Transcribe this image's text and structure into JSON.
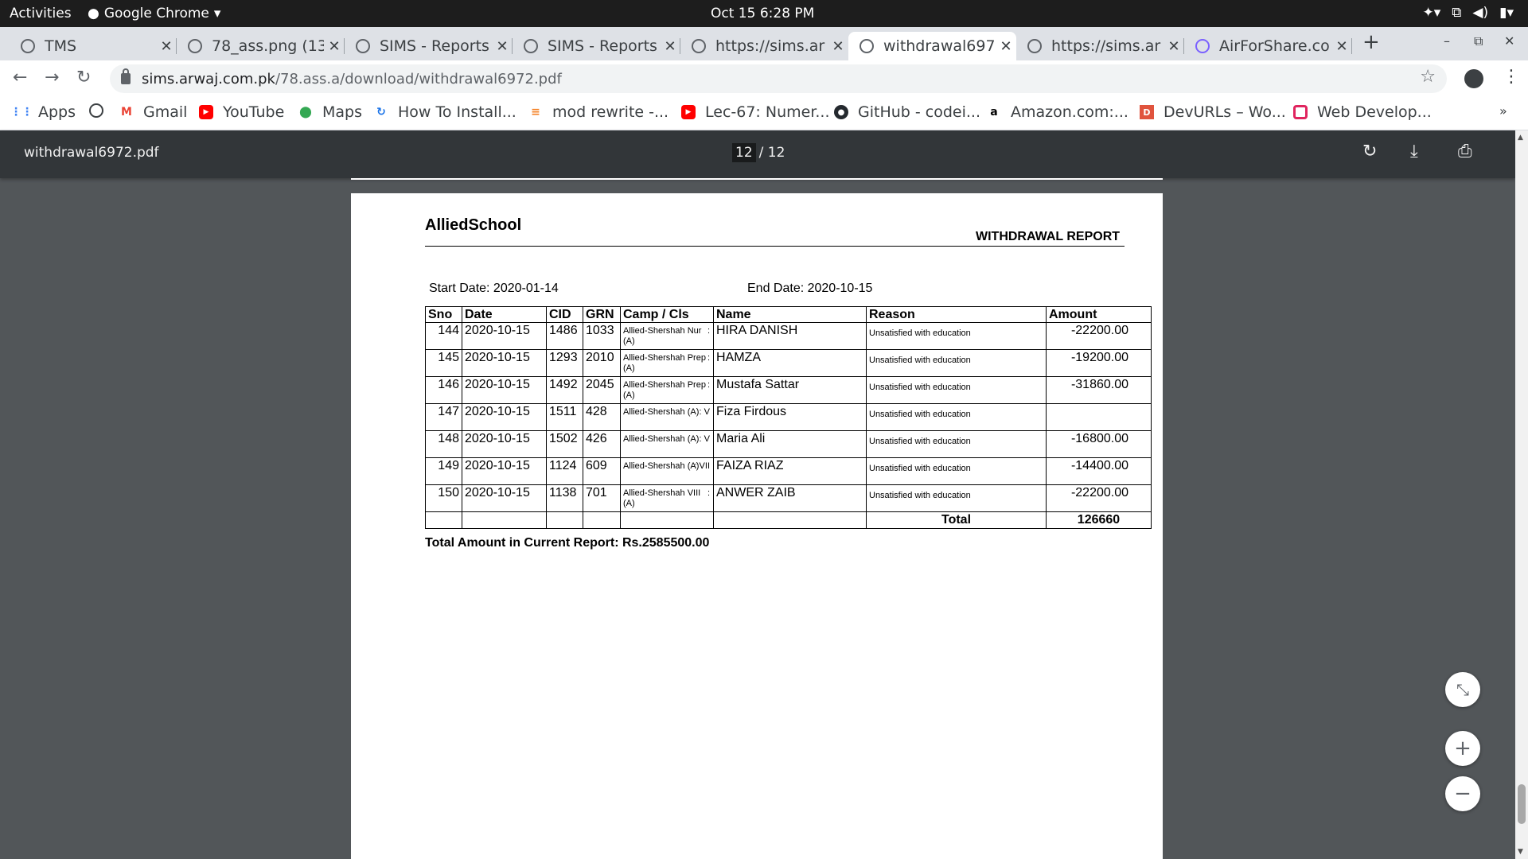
{
  "system": {
    "activities": "Activities",
    "app_name": "Google Chrome",
    "clock": "Oct 15  6:28 PM"
  },
  "tabs": [
    {
      "title": "TMS"
    },
    {
      "title": "78_ass.png (13"
    },
    {
      "title": "SIMS - Reports"
    },
    {
      "title": "SIMS - Reports"
    },
    {
      "title": "https://sims.ar"
    },
    {
      "title": "withdrawal697"
    },
    {
      "title": "https://sims.ar"
    },
    {
      "title": "AirForShare.co"
    }
  ],
  "address": {
    "host": "sims.arwaj.com.pk",
    "path": "/78.ass.a/download/withdrawal6972.pdf"
  },
  "bookmarks": [
    {
      "label": "Apps",
      "icon": "apps-grid-icon"
    },
    {
      "label": "",
      "icon": "globe-icon"
    },
    {
      "label": "Gmail",
      "icon": "gmail-icon"
    },
    {
      "label": "YouTube",
      "icon": "youtube-icon"
    },
    {
      "label": "Maps",
      "icon": "maps-icon"
    },
    {
      "label": "How To Install...",
      "icon": "refresh-blue-icon"
    },
    {
      "label": "mod rewrite -...",
      "icon": "stackoverflow-icon"
    },
    {
      "label": "Lec-67: Numer...",
      "icon": "youtube-icon"
    },
    {
      "label": "GitHub - codei...",
      "icon": "github-icon"
    },
    {
      "label": "Amazon.com:...",
      "icon": "amazon-icon"
    },
    {
      "label": "DevURLs – Wo...",
      "icon": "devurls-icon"
    },
    {
      "label": "Web Develop...",
      "icon": "webdev-icon"
    }
  ],
  "pdf": {
    "filename": "withdrawal6972.pdf",
    "current_page": "12",
    "total_pages": "/ 12"
  },
  "report": {
    "school": "AlliedSchool",
    "title": "WITHDRAWAL REPORT",
    "start_date": "Start Date: 2020-01-14",
    "end_date": "End Date: 2020-10-15",
    "columns": [
      "Sno",
      "Date",
      "CID",
      "GRN",
      "Camp / Cls",
      "Name",
      "Reason",
      "Amount"
    ],
    "rows": [
      {
        "sno": "144",
        "date": "2020-10-15",
        "cid": "1486",
        "grn": "1033",
        "camp": "Allied-Shershah Nur (A)",
        "cls": ":",
        "name": "HIRA DANISH",
        "reason": "Unsatisfied with education",
        "amount": "-22200.00"
      },
      {
        "sno": "145",
        "date": "2020-10-15",
        "cid": "1293",
        "grn": "2010",
        "camp": "Allied-Shershah Prep (A)",
        "cls": ":",
        "name": "HAMZA",
        "reason": "Unsatisfied with education",
        "amount": "-19200.00"
      },
      {
        "sno": "146",
        "date": "2020-10-15",
        "cid": "1492",
        "grn": "2045",
        "camp": "Allied-Shershah Prep (A)",
        "cls": ":",
        "name": "Mustafa Sattar",
        "reason": "Unsatisfied with education",
        "amount": "-31860.00"
      },
      {
        "sno": "147",
        "date": "2020-10-15",
        "cid": "1511",
        "grn": "428",
        "camp": "Allied-Shershah (A)",
        "cls": ":  V",
        "name": "Fiza Firdous",
        "reason": "Unsatisfied with education",
        "amount": ""
      },
      {
        "sno": "148",
        "date": "2020-10-15",
        "cid": "1502",
        "grn": "426",
        "camp": "Allied-Shershah (A)",
        "cls": ":  V",
        "name": "Maria Ali",
        "reason": "Unsatisfied with education",
        "amount": "-16800.00"
      },
      {
        "sno": "149",
        "date": "2020-10-15",
        "cid": "1124",
        "grn": "609",
        "camp": "Allied-Shershah (A)",
        "cls": ": VII",
        "name": "FAIZA RIAZ",
        "reason": "Unsatisfied with education",
        "amount": "-14400.00"
      },
      {
        "sno": "150",
        "date": "2020-10-15",
        "cid": "1138",
        "grn": "701",
        "camp": "Allied-Shershah VIII (A)",
        "cls": ":",
        "name": "ANWER ZAIB",
        "reason": "Unsatisfied with education",
        "amount": "-22200.00"
      }
    ],
    "total_label": "Total",
    "total_value": "126660",
    "grand_total": "Total Amount in Current Report: Rs.2585500.00"
  }
}
